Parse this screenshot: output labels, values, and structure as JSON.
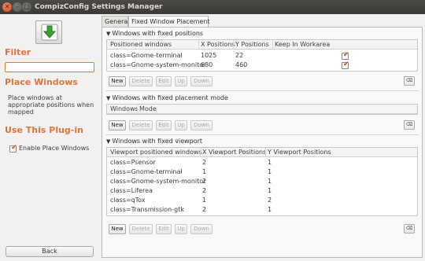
{
  "window": {
    "title": "CompizConfig Settings Manager"
  },
  "sidebar": {
    "filter_heading": "Filter",
    "filter_value": "",
    "plugin_heading": "Place Windows",
    "plugin_description": "Place windows at appropriate positions when mapped",
    "use_heading": "Use This Plug-in",
    "enable_label": "Enable Place Windows",
    "enable_checked": true,
    "back_label": "Back"
  },
  "tabs": [
    {
      "label": "General"
    },
    {
      "label": "Fixed Window Placement"
    }
  ],
  "sections": {
    "fixed_positions": {
      "title": "Windows with fixed positions",
      "columns": [
        "Positioned windows",
        "X Positions",
        "Y Positions",
        "Keep In Workarea"
      ],
      "rows": [
        {
          "window": "class=Gnome-terminal",
          "x": "1025",
          "y": "22",
          "keep": true
        },
        {
          "window": "class=Gnome-system-monitor",
          "x": "680",
          "y": "460",
          "keep": true
        }
      ]
    },
    "placement_mode": {
      "title": "Windows with fixed placement mode",
      "columns": [
        "Windows",
        "Mode"
      ]
    },
    "fixed_viewport": {
      "title": "Windows with fixed viewport",
      "columns": [
        "Viewport positioned windows",
        "X Viewport Positions",
        "Y Viewport Positions"
      ],
      "rows": [
        {
          "window": "class=Psensor",
          "x": "2",
          "y": "1"
        },
        {
          "window": "class=Gnome-terminal",
          "x": "1",
          "y": "1"
        },
        {
          "window": "class=Gnome-system-monitor",
          "x": "2",
          "y": "1"
        },
        {
          "window": "class=Liferea",
          "x": "2",
          "y": "1"
        },
        {
          "window": "class=qTox",
          "x": "1",
          "y": "2"
        },
        {
          "window": "class=Transmission-gtk",
          "x": "2",
          "y": "1"
        }
      ]
    }
  },
  "buttons": {
    "new": "New",
    "delete": "Delete",
    "edit": "Edit",
    "up": "Up",
    "down": "Down"
  },
  "icons": {
    "close": "close-icon",
    "minimize": "minimize-icon",
    "maximize": "maximize-icon",
    "plugin": "down-arrow-icon",
    "clear": "clear-icon",
    "erase": "backspace-icon"
  },
  "colors": {
    "accent": "#e0743d",
    "check": "#dd4814",
    "titlebar": "#3b3a36"
  }
}
